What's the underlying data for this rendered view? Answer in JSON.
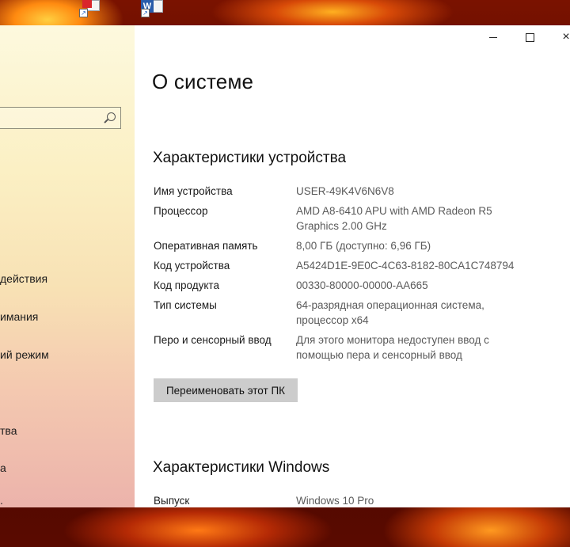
{
  "desktop": {
    "icons": [
      {
        "name": "pdf-shortcut-icon"
      },
      {
        "name": "word-shortcut-icon",
        "glyph": "W"
      }
    ]
  },
  "sidebar": {
    "search": {
      "placeholder": "",
      "icon": "search-icon"
    },
    "items": [
      {
        "label": "действия"
      },
      {
        "label": "имания"
      },
      {
        "label": "ий режим"
      },
      {
        "label": "тва"
      },
      {
        "label": "а"
      }
    ]
  },
  "window": {
    "controls": {
      "minimize": "minimize-icon",
      "maximize": "maximize-icon",
      "close": "×"
    }
  },
  "page": {
    "title": "О системе",
    "device_section": {
      "title": "Характеристики устройства",
      "rows": [
        {
          "label": "Имя устройства",
          "value": "USER-49K4V6N6V8"
        },
        {
          "label": "Процессор",
          "value": "AMD A8-6410 APU with AMD Radeon R5\nGraphics       2.00 GHz"
        },
        {
          "label": "Оперативная память",
          "value": "8,00 ГБ (доступно: 6,96 ГБ)"
        },
        {
          "label": "Код устройства",
          "value": "A5424D1E-9E0C-4C63-8182-80CA1C748794"
        },
        {
          "label": "Код продукта",
          "value": "00330-80000-00000-AA665"
        },
        {
          "label": "Тип системы",
          "value": "64-разрядная операционная система,\nпроцессор x64"
        },
        {
          "label": "Перо и сенсорный ввод",
          "value": "Для этого монитора недоступен ввод с\nпомощью пера и сенсорный ввод"
        }
      ],
      "rename_button": "Переименовать этот ПК"
    },
    "windows_section": {
      "title": "Характеристики Windows",
      "rows": [
        {
          "label": "Выпуск",
          "value": "Windows 10 Pro"
        }
      ]
    }
  },
  "colors": {
    "content_bg": "#ffffff",
    "value_text": "#5a5a5a",
    "button_bg": "#cccccc",
    "wallpaper": "#7a1200"
  }
}
